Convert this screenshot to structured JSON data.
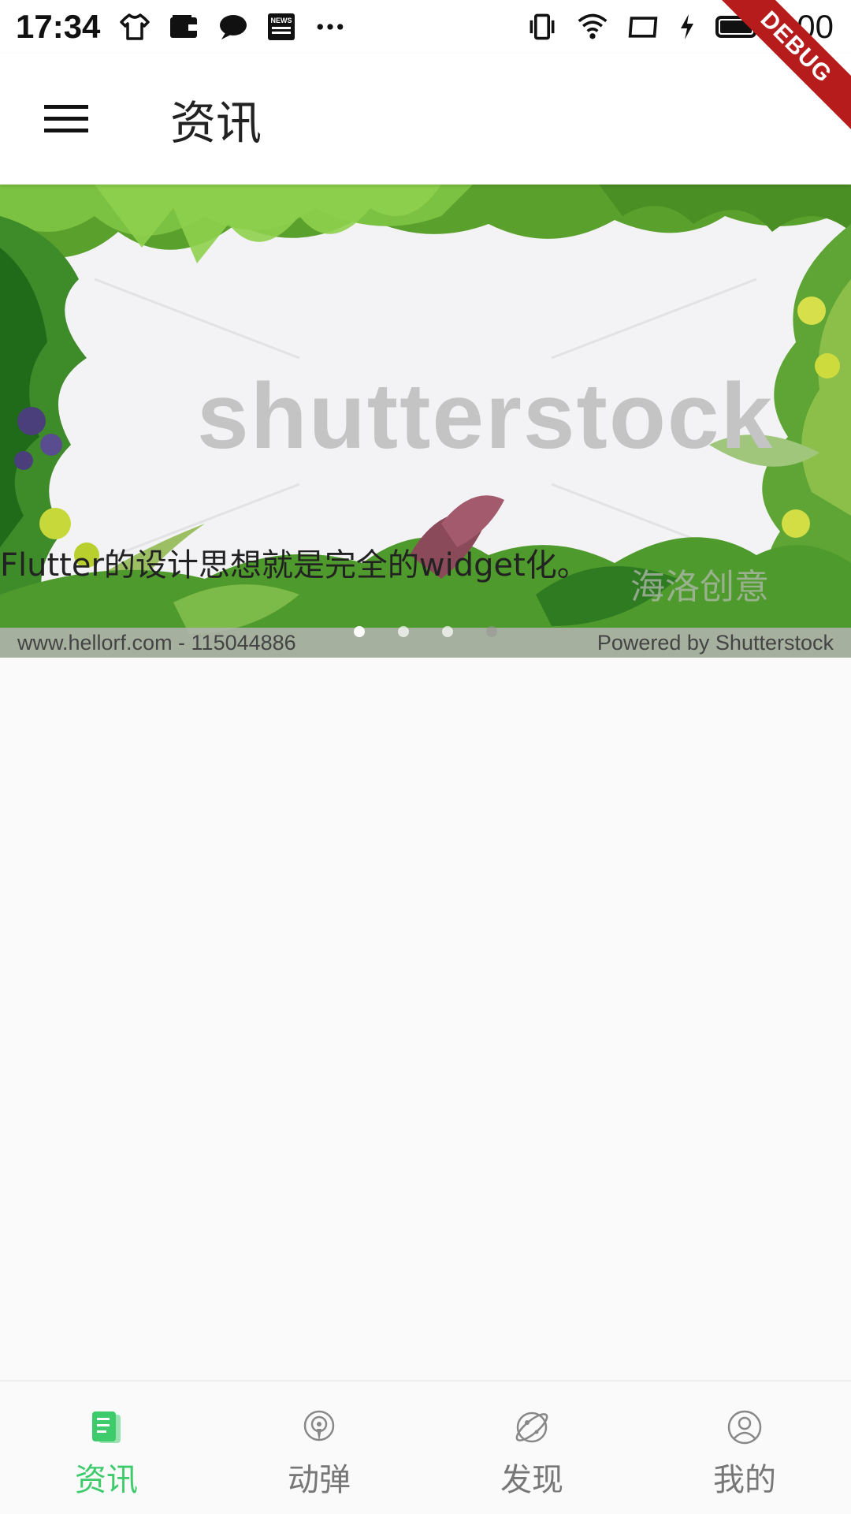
{
  "status_bar": {
    "time": "17:34",
    "battery": "100",
    "left_icons": [
      "shirt-icon",
      "wallet-icon",
      "chat-bubble-icon",
      "news-icon",
      "more-dots-icon"
    ],
    "right_icons": [
      "vibrate-icon",
      "wifi-icon",
      "screen-icon",
      "charging-icon",
      "battery-icon"
    ]
  },
  "debug_banner": "DEBUG",
  "app_bar": {
    "title": "资讯",
    "menu_icon": "hamburger-menu-icon"
  },
  "carousel": {
    "watermark": "shutterstock",
    "watermark_cn": "海洛创意",
    "caption": "Flutter的设计思想就是完全的widget化。",
    "credit_left": "www.hellorf.com - 115044886",
    "credit_right": "Powered by Shutterstock",
    "page_count": 4,
    "active_index": 0
  },
  "bottom_nav": {
    "active_color": "#3dcb6b",
    "inactive_color": "#777777",
    "items": [
      {
        "label": "资讯",
        "icon": "news-doc-icon",
        "active": true
      },
      {
        "label": "动弹",
        "icon": "podcast-icon",
        "active": false
      },
      {
        "label": "发现",
        "icon": "planet-icon",
        "active": false
      },
      {
        "label": "我的",
        "icon": "user-circle-icon",
        "active": false
      }
    ]
  }
}
